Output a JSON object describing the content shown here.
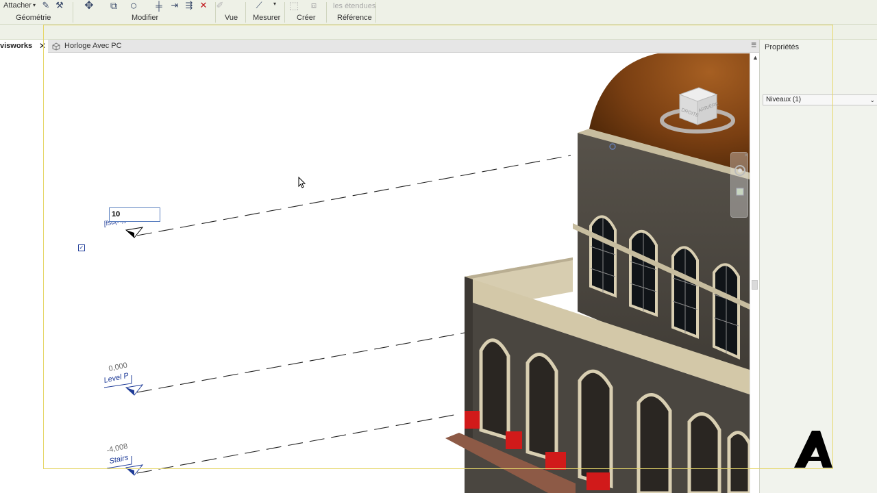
{
  "ribbon": {
    "attach_label": "Attacher",
    "extents_label": "les étendues",
    "panels": [
      "Géométrie",
      "Modifier",
      "Vue",
      "Mesurer",
      "Créer",
      "Référence"
    ]
  },
  "tabs": {
    "left_tab_label": "visworks",
    "left_tab_close": "✕",
    "view_tab_label": "Horloge Avec PC"
  },
  "properties": {
    "title": "Propriétés",
    "type_selector": "Niveaux (1)"
  },
  "levels": [
    {
      "name": "[fsd(R)]",
      "elevation": ""
    },
    {
      "name": "Level P",
      "elevation": "0,000"
    },
    {
      "name": "Stairs",
      "elevation": "-4,008"
    }
  ],
  "edit_value": "10",
  "viewcube": {
    "face_label": "ARRIÈRE",
    "side_label": "DROITE"
  },
  "colors": {
    "ribbon_bg": "#eef1e7",
    "level_blue": "#1f3c98",
    "dome": "#8a4a1a",
    "wall_dark": "#4a4640",
    "stone": "#c9bfa4",
    "accent_red": "#d11a1a",
    "frame_yellow": "#e6d76a"
  }
}
